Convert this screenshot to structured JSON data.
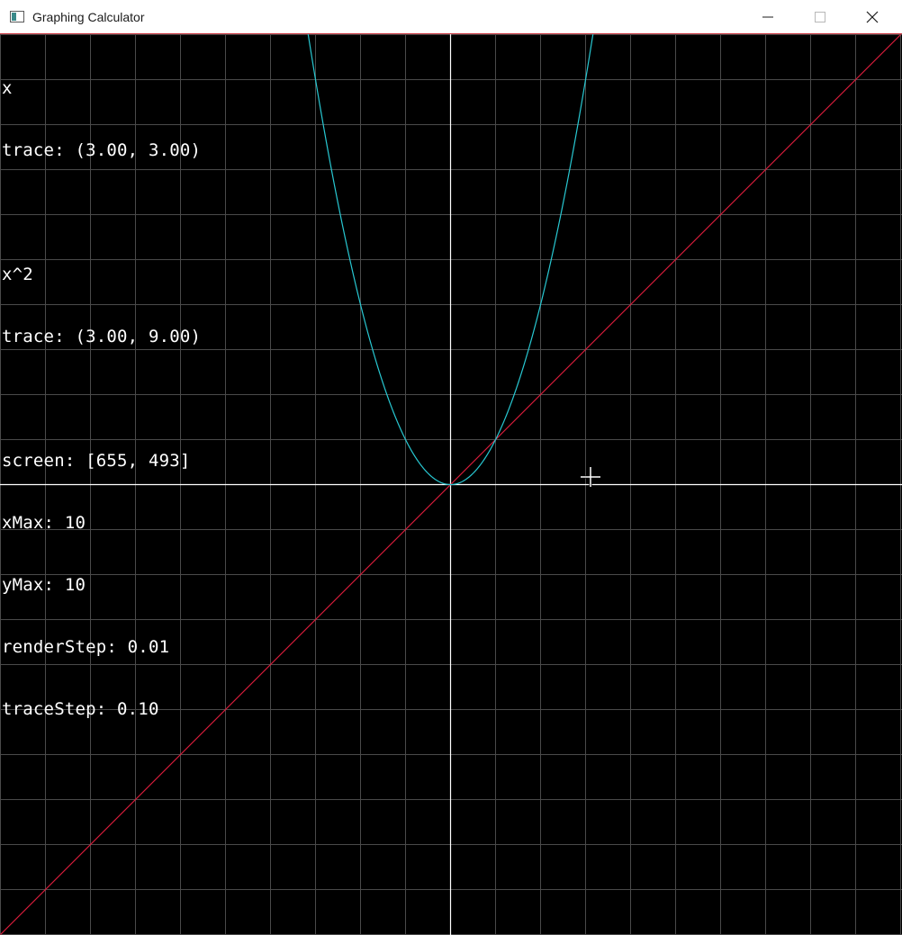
{
  "window": {
    "title": "Graphing Calculator",
    "icon": "app-window-icon",
    "controls": [
      "minimize-icon",
      "maximize-icon",
      "close-icon"
    ]
  },
  "graph": {
    "xMax": 10,
    "yMax": 10,
    "background_color": "#000000",
    "grid_color": "#4a4a4a",
    "axis_color": "#ffffff",
    "functions": [
      {
        "expression": "x",
        "color": "#dc1e3c"
      },
      {
        "expression": "x^2",
        "color": "#28c8d2"
      }
    ]
  },
  "overlay": {
    "f1_expr": "x",
    "f1_trace": "trace: (3.00, 3.00)",
    "f2_expr": "x^2",
    "f2_trace": "trace: (3.00, 9.00)",
    "screen": "screen: [655, 493]",
    "xmax": "xMax: 10",
    "ymax": "yMax: 10",
    "render_step": "renderStep: 0.01",
    "trace_step": "traceStep: 0.10"
  },
  "cursor": {
    "icon": "crosshair-cursor-icon"
  }
}
